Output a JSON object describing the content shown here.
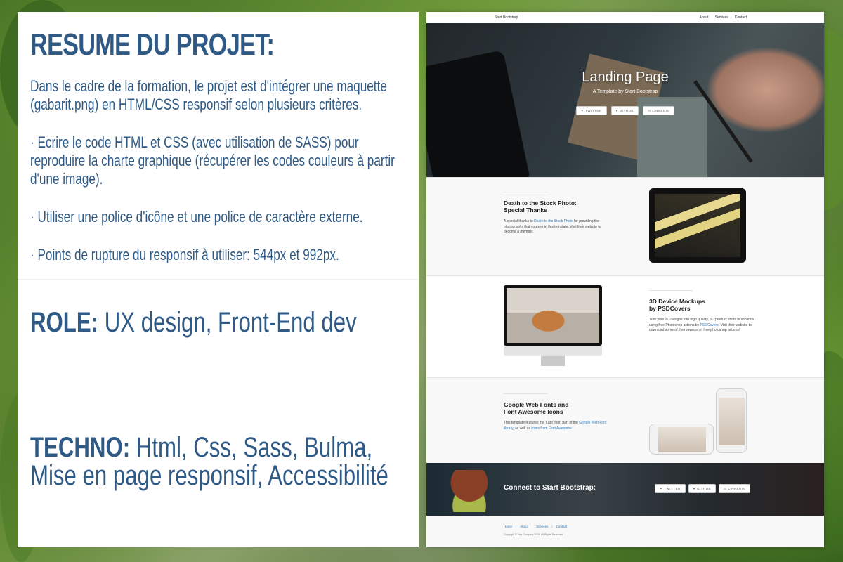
{
  "info": {
    "title": "RESUME DU PROJET:",
    "paragraphs": [
      "Dans le cadre de la formation, le projet est d'intégrer une maquette (gabarit.png) en HTML/CSS responsif selon plusieurs critères.",
      "· Ecrire le code HTML et CSS (avec utilisation de SASS) pour reproduire la charte graphique (récupérer les codes couleurs à partir d'une image).",
      "· Utiliser une police d'icône et une police de caractère externe.",
      "· Points de rupture du responsif à utiliser: 544px et 992px."
    ],
    "role_label": "ROLE:",
    "role_value": "UX design, Front-End dev",
    "techno_label": "TECHNO:",
    "techno_value": "Html, Css, Sass, Bulma, Mise en page responsif, Accessibilité"
  },
  "mock": {
    "brand": "Start Bootstrap",
    "nav": [
      "About",
      "Services",
      "Contact"
    ],
    "hero": {
      "title": "Landing Page",
      "subtitle": "A Template by Start Bootstrap",
      "buttons": [
        "TWITTER",
        "GITHUB",
        "LINKEDIN"
      ]
    },
    "sections": [
      {
        "heading_1": "Death to the Stock Photo:",
        "heading_2": "Special Thanks",
        "body_pre": "A special thanks to ",
        "link": "Death to the Stock Photo",
        "body_post": " for providing the photographs that you see in this template. Visit their website to become a member."
      },
      {
        "heading_1": "3D Device Mockups",
        "heading_2": "by PSDCovers",
        "body_pre": "Turn your 2D designs into high quality, 3D product shots in seconds using free Photoshop actions by ",
        "link": "PSDCovers",
        "body_post": "! Visit their website to download some of their awesome, free photoshop actions!"
      },
      {
        "heading_1": "Google Web Fonts and",
        "heading_2": "Font Awesome Icons",
        "body_pre": "This template features the 'Lato' font, part of the ",
        "link": "Google Web Font library",
        "body_mid": ", as well as ",
        "link2": "icons from Font Awesome",
        "body_post": "."
      }
    ],
    "cta": {
      "title": "Connect to Start Bootstrap:",
      "buttons": [
        "TWITTER",
        "GITHUB",
        "LINKEDIN"
      ]
    },
    "footer": {
      "links": [
        "Home",
        "About",
        "Services",
        "Contact"
      ],
      "separator": "|",
      "copyright": "Copyright © Your Company 2014. All Rights Reserved"
    }
  },
  "colors": {
    "info_text": "#2f5a86",
    "link": "#337ab7"
  },
  "icons": [
    "twitter-icon",
    "github-icon",
    "linkedin-icon"
  ]
}
